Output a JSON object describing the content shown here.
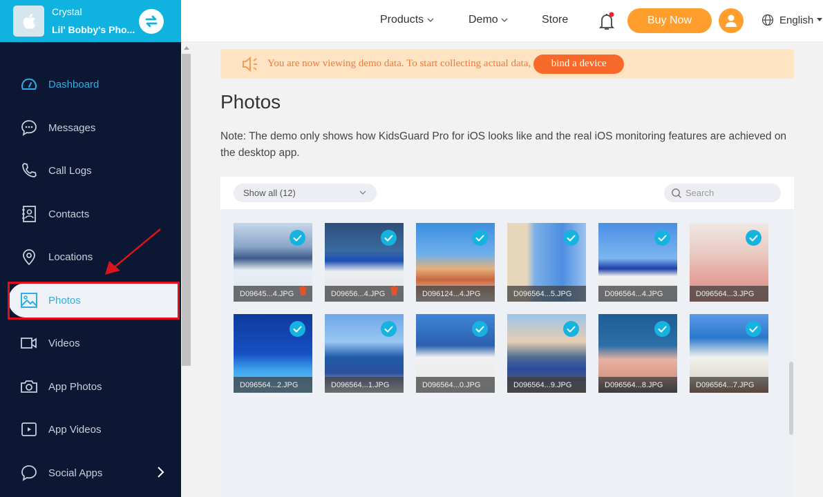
{
  "device": {
    "name": "Crystal",
    "phone": "Lil' Bobby's Pho..."
  },
  "sidebar": {
    "items": [
      {
        "label": "Dashboard",
        "icon": "dashboard-icon"
      },
      {
        "label": "Messages",
        "icon": "messages-icon"
      },
      {
        "label": "Call Logs",
        "icon": "phone-icon"
      },
      {
        "label": "Contacts",
        "icon": "contacts-icon"
      },
      {
        "label": "Locations",
        "icon": "location-pin-icon"
      },
      {
        "label": "Photos",
        "icon": "image-icon",
        "selected": true
      },
      {
        "label": "Videos",
        "icon": "video-camera-icon"
      },
      {
        "label": "App Photos",
        "icon": "camera-icon"
      },
      {
        "label": "App Videos",
        "icon": "play-icon"
      },
      {
        "label": "Social Apps",
        "icon": "chat-bubble-icon",
        "has_submenu": true
      }
    ]
  },
  "topbar": {
    "products": "Products",
    "demo": "Demo",
    "store": "Store",
    "buy_now": "Buy Now",
    "language": "English"
  },
  "banner": {
    "text": "You are now viewing demo data. To start collecting actual data,",
    "button": "bind a device"
  },
  "page": {
    "title": "Photos",
    "note": "Note: The demo only shows how KidsGuard Pro for iOS looks like and the real iOS monitoring features are achieved on the desktop app."
  },
  "toolbar": {
    "filter_label": "Show all (12)",
    "search_placeholder": "Search"
  },
  "photos": [
    {
      "name": "D09645...4.JPG",
      "checked": true,
      "trash": true
    },
    {
      "name": "D09656...4.JPG",
      "checked": true,
      "trash": true
    },
    {
      "name": "D096124...4.JPG",
      "checked": true,
      "trash": false
    },
    {
      "name": "D096564...5.JPG",
      "checked": true,
      "trash": false
    },
    {
      "name": "D096564...4.JPG",
      "checked": true,
      "trash": false
    },
    {
      "name": "D096564...3.JPG",
      "checked": true,
      "trash": false
    },
    {
      "name": "D096564...2.JPG",
      "checked": true,
      "trash": false
    },
    {
      "name": "D096564...1.JPG",
      "checked": true,
      "trash": false
    },
    {
      "name": "D096564...0.JPG",
      "checked": true,
      "trash": false
    },
    {
      "name": "D096564...9.JPG",
      "checked": true,
      "trash": false
    },
    {
      "name": "D096564...8.JPG",
      "checked": true,
      "trash": false
    },
    {
      "name": "D096564...7.JPG",
      "checked": true,
      "trash": false
    }
  ],
  "colors": {
    "sidebar_bg": "#0b1733",
    "header_bg": "#10b3e0",
    "accent_orange": "#ff9e2d",
    "bind_button": "#f86a2c",
    "check_blue": "#17b3e0",
    "highlight_red": "#e0101a"
  }
}
